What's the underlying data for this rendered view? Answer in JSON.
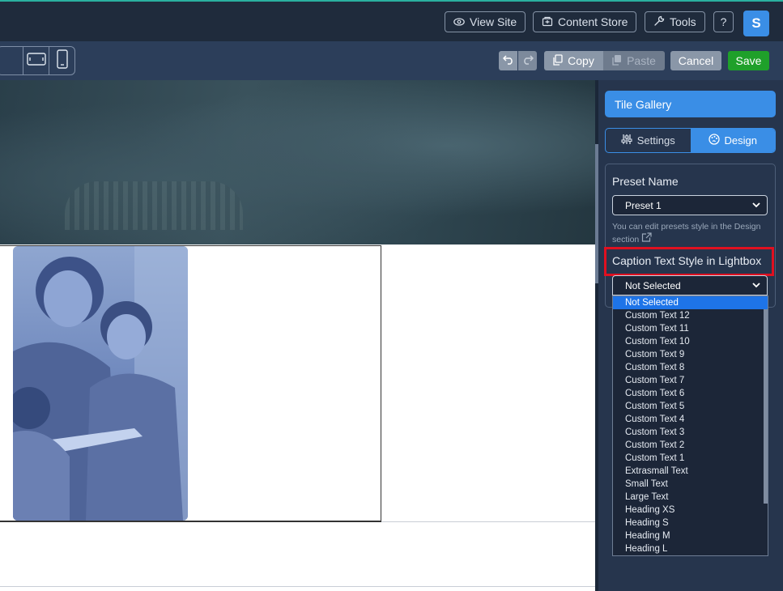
{
  "topbar": {
    "view_site": "View Site",
    "content_store": "Content Store",
    "tools": "Tools",
    "help": "?",
    "avatar": "S"
  },
  "toolbar": {
    "copy": "Copy",
    "paste": "Paste",
    "cancel": "Cancel",
    "save": "Save"
  },
  "panel": {
    "title": "Tile Gallery",
    "tabs": [
      "Settings",
      "Design"
    ],
    "preset_label": "Preset Name",
    "preset_value": "Preset 1",
    "hint_text": "You can edit presets style in the Design section",
    "caption_label": "Caption Text Style in Lightbox",
    "caption_value": "Not Selected",
    "options": [
      "Not Selected",
      "Custom Text 12",
      "Custom Text 11",
      "Custom Text 10",
      "Custom Text 9",
      "Custom Text 8",
      "Custom Text 7",
      "Custom Text 6",
      "Custom Text 5",
      "Custom Text 4",
      "Custom Text 3",
      "Custom Text 2",
      "Custom Text 1",
      "Extrasmall Text",
      "Small Text",
      "Large Text",
      "Heading XS",
      "Heading S",
      "Heading M",
      "Heading L"
    ]
  },
  "colors": {
    "accent": "#3a8ee6",
    "save": "#1fa02a",
    "highlight": "#e01020"
  }
}
